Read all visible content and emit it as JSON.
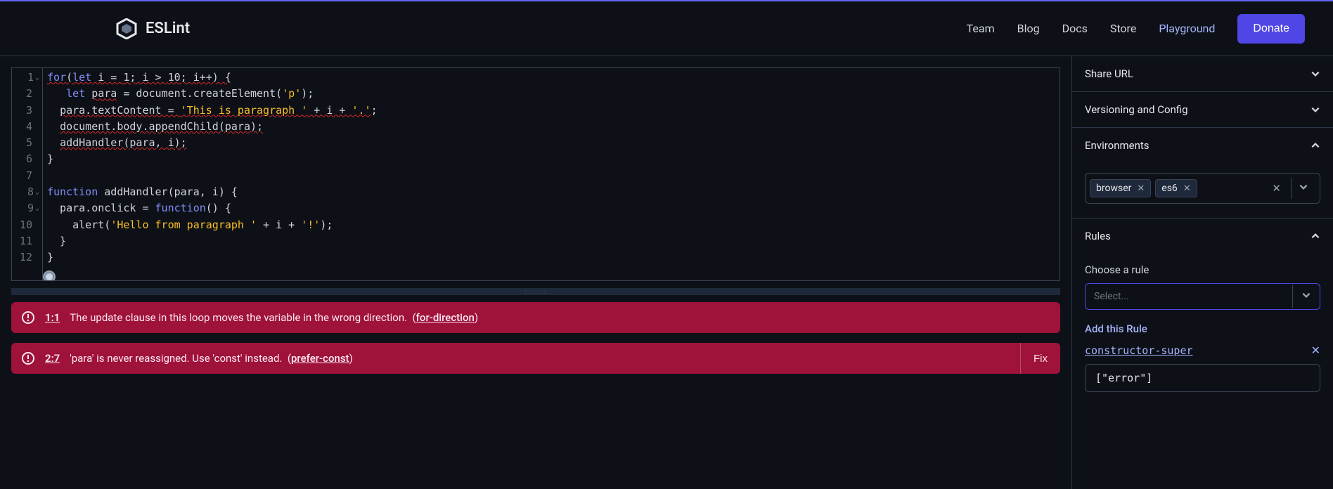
{
  "header": {
    "brand": "ESLint",
    "nav": [
      "Team",
      "Blog",
      "Docs",
      "Store",
      "Playground"
    ],
    "active_nav": "Playground",
    "donate": "Donate"
  },
  "editor": {
    "lines": [
      {
        "n": 1,
        "fold": true
      },
      {
        "n": 2,
        "fold": false
      },
      {
        "n": 3,
        "fold": false
      },
      {
        "n": 4,
        "fold": false
      },
      {
        "n": 5,
        "fold": false
      },
      {
        "n": 6,
        "fold": false
      },
      {
        "n": 7,
        "fold": false
      },
      {
        "n": 8,
        "fold": true
      },
      {
        "n": 9,
        "fold": true
      },
      {
        "n": 10,
        "fold": false
      },
      {
        "n": 11,
        "fold": false
      },
      {
        "n": 12,
        "fold": false
      }
    ],
    "code_tokens": [
      [
        {
          "t": "for",
          "c": "kw err-underline"
        },
        {
          "t": "(",
          "c": "err-underline"
        },
        {
          "t": "let",
          "c": "kw err-underline"
        },
        {
          "t": " i = ",
          "c": "err-underline"
        },
        {
          "t": "1",
          "c": "num err-underline"
        },
        {
          "t": "; i > ",
          "c": "err-underline"
        },
        {
          "t": "10",
          "c": "num err-underline"
        },
        {
          "t": "; i++) {",
          "c": "err-underline"
        }
      ],
      [
        {
          "t": "   ",
          "c": ""
        },
        {
          "t": "let",
          "c": "kw"
        },
        {
          "t": " ",
          "c": ""
        },
        {
          "t": "para",
          "c": "err-underline"
        },
        {
          "t": " = document.createElement(",
          "c": ""
        },
        {
          "t": "'p'",
          "c": "str"
        },
        {
          "t": ");",
          "c": ""
        }
      ],
      [
        {
          "t": "  ",
          "c": ""
        },
        {
          "t": "para.textContent = ",
          "c": "err-underline"
        },
        {
          "t": "'This is paragraph '",
          "c": "str err-underline"
        },
        {
          "t": " + i + ",
          "c": "err-underline"
        },
        {
          "t": "'.'",
          "c": "str err-underline"
        },
        {
          "t": ";",
          "c": ""
        }
      ],
      [
        {
          "t": "  ",
          "c": ""
        },
        {
          "t": "document.body.appendChild(para);",
          "c": "err-underline"
        }
      ],
      [
        {
          "t": "  ",
          "c": ""
        },
        {
          "t": "addHandler(para, i);",
          "c": "err-underline"
        }
      ],
      [
        {
          "t": "}",
          "c": ""
        }
      ],
      [
        {
          "t": "",
          "c": ""
        }
      ],
      [
        {
          "t": "function",
          "c": "kw"
        },
        {
          "t": " addHandler(para, i) {",
          "c": ""
        }
      ],
      [
        {
          "t": "  para.onclick = ",
          "c": ""
        },
        {
          "t": "function",
          "c": "kw"
        },
        {
          "t": "() {",
          "c": ""
        }
      ],
      [
        {
          "t": "    alert(",
          "c": ""
        },
        {
          "t": "'Hello from paragraph '",
          "c": "str"
        },
        {
          "t": " + i + ",
          "c": ""
        },
        {
          "t": "'!'",
          "c": "str"
        },
        {
          "t": ");",
          "c": ""
        }
      ],
      [
        {
          "t": "  }",
          "c": ""
        }
      ],
      [
        {
          "t": "}",
          "c": ""
        }
      ]
    ]
  },
  "errors": [
    {
      "loc": "1:1",
      "msg": "The update clause in this loop moves the variable in the wrong direction.",
      "rule": "for-direction",
      "fixable": false
    },
    {
      "loc": "2:7",
      "msg": "'para' is never reassigned. Use 'const' instead.",
      "rule": "prefer-const",
      "fixable": true,
      "fix_label": "Fix"
    }
  ],
  "sidebar": {
    "panels": {
      "share": {
        "title": "Share URL",
        "open": false
      },
      "version": {
        "title": "Versioning and Config",
        "open": false
      },
      "env": {
        "title": "Environments",
        "open": true,
        "tags": [
          "browser",
          "es6"
        ]
      },
      "rules": {
        "title": "Rules",
        "open": true,
        "choose_label": "Choose a rule",
        "select_placeholder": "Select...",
        "add_label": "Add this Rule",
        "rule_name": "constructor-super",
        "rule_config": "[\"error\"]"
      }
    }
  }
}
